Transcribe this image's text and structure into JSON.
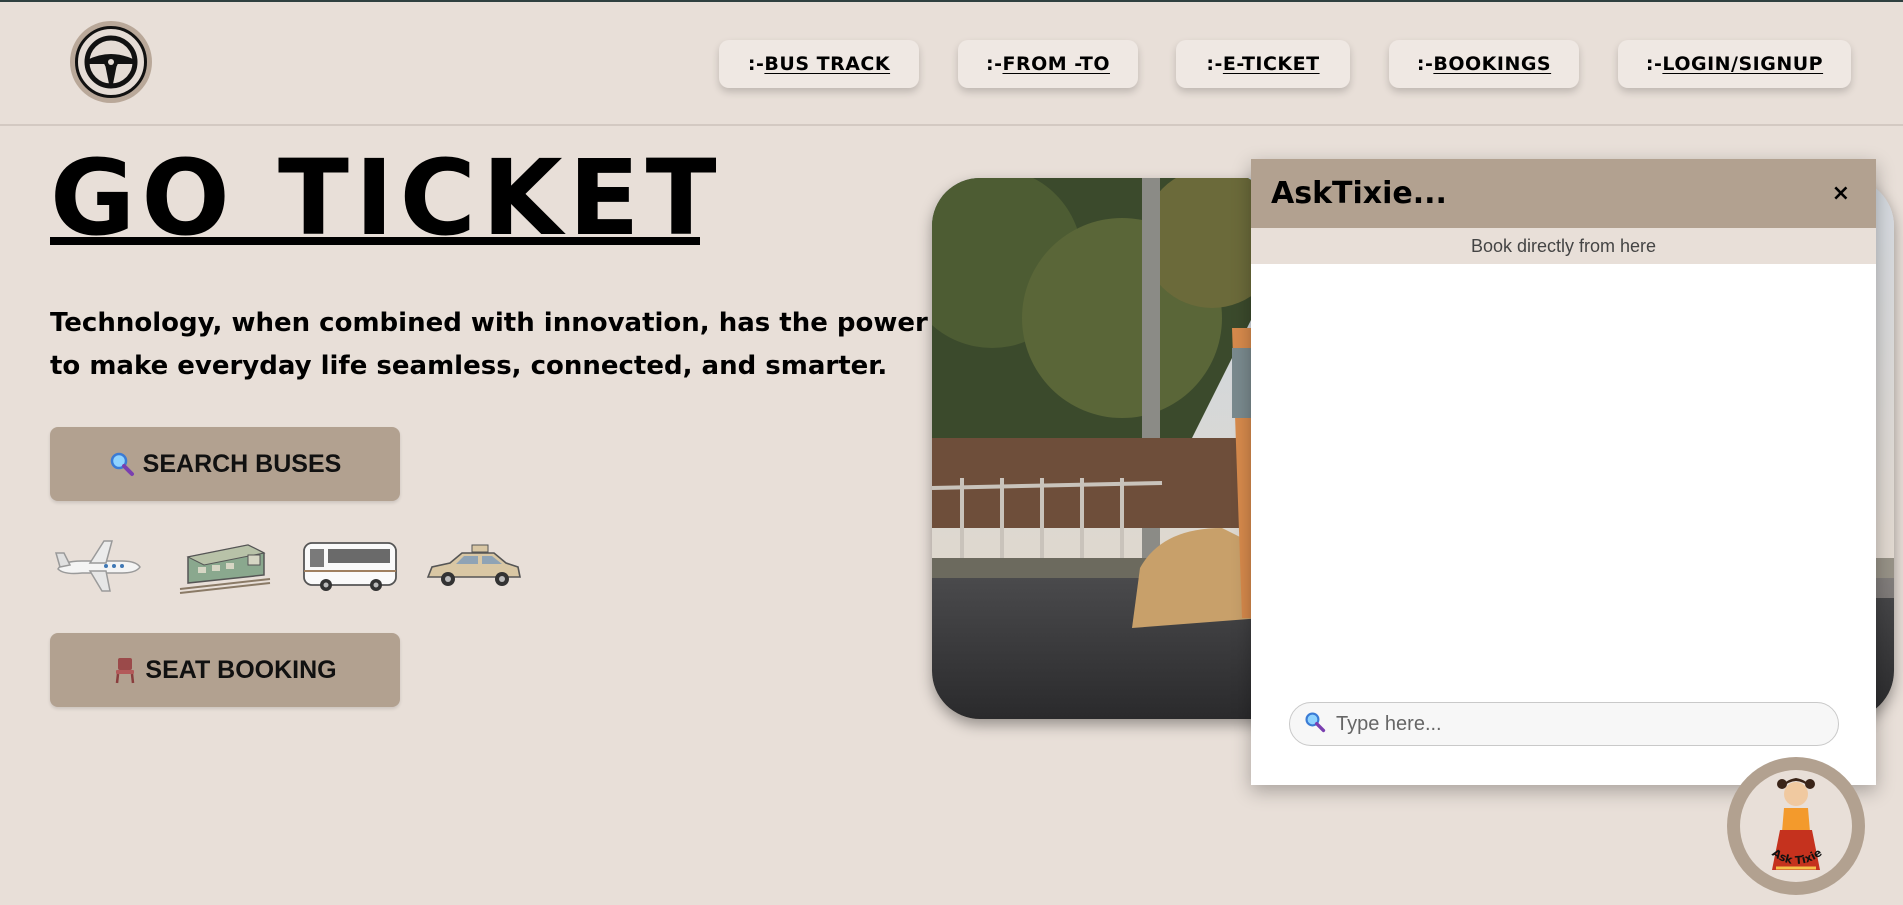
{
  "nav": {
    "items": [
      {
        "prefix": ":-",
        "label": " BUS TRACK"
      },
      {
        "prefix": ":-",
        "label": " FROM -TO"
      },
      {
        "prefix": ":-",
        "label": " E-TICKET"
      },
      {
        "prefix": ":-",
        "label": " BOOKINGS"
      },
      {
        "prefix": ":-",
        "label": " LOGIN/SIGNUP"
      }
    ]
  },
  "logo": {
    "icon": "steering-wheel-icon"
  },
  "hero": {
    "title": "GO TICKET",
    "tagline": "Technology, when combined with innovation, has the power to make everyday life seamless, connected, and smarter."
  },
  "buttons": {
    "search_buses": "SEARCH BUSES",
    "seat_booking": "SEAT BOOKING"
  },
  "transport_icons": [
    "airplane-icon",
    "train-icon",
    "bus-icon",
    "taxi-icon"
  ],
  "chat": {
    "title": "AskTixie...",
    "close": "×",
    "subtitle": "Book directly from here",
    "input_placeholder": "Type here..."
  },
  "fab": {
    "label": "Ask Tixie"
  },
  "colors": {
    "background": "#e8dfd8",
    "accent": "#b2a190",
    "text": "#000000"
  }
}
